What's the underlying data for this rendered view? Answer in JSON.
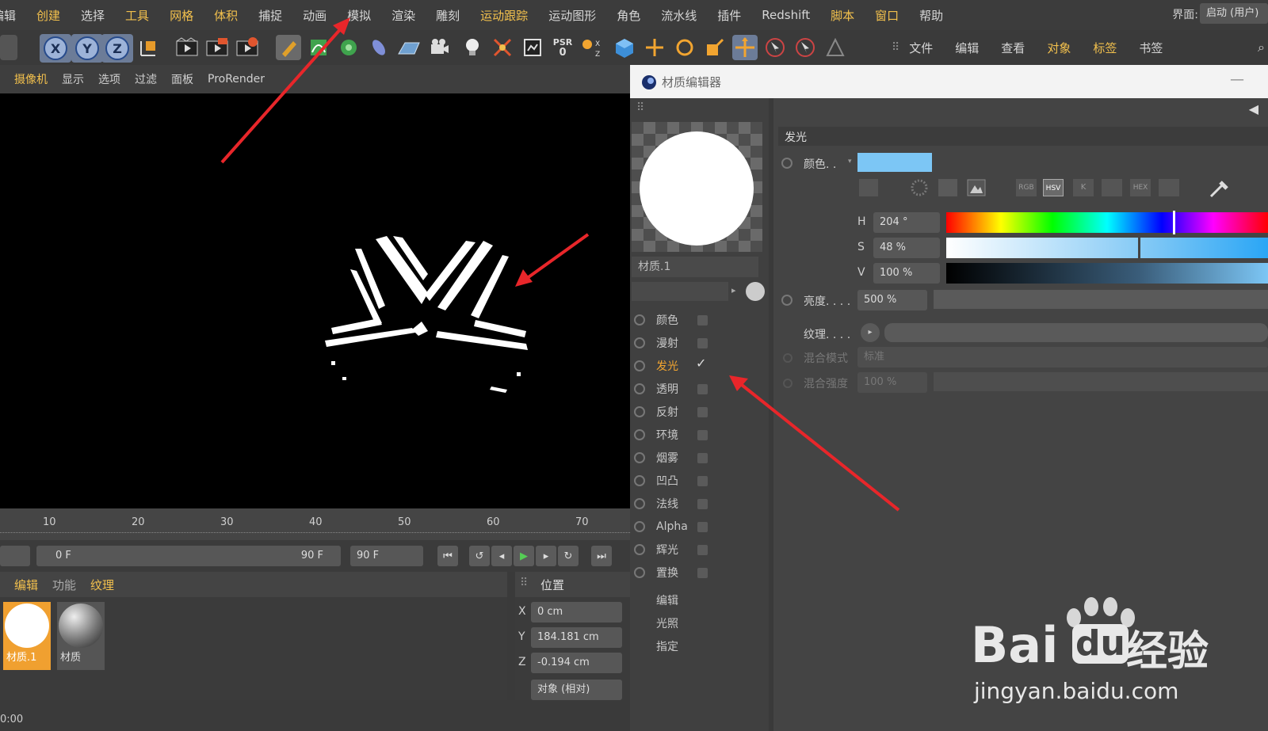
{
  "menubar": {
    "items": [
      "编辑",
      "创建",
      "选择",
      "工具",
      "网格",
      "体积",
      "捕捉",
      "动画",
      "模拟",
      "渲染",
      "雕刻",
      "运动跟踪",
      "运动图形",
      "角色",
      "流水线",
      "插件",
      "Redshift",
      "脚本",
      "窗口",
      "帮助"
    ],
    "highlighted": [
      11,
      17,
      18
    ],
    "ui_label": "界面:",
    "ui_value": "启动 (用户)"
  },
  "toolbar": {
    "axes": [
      "X",
      "Y",
      "Z"
    ],
    "psr_label": "PSR",
    "psr_value": "0"
  },
  "right_menu": [
    "文件",
    "编辑",
    "查看",
    "对象",
    "标签",
    "书签"
  ],
  "right_menu_highlighted": [
    3,
    4
  ],
  "viewport_menu": [
    "摄像机",
    "显示",
    "选项",
    "过滤",
    "面板",
    "ProRender"
  ],
  "timeline": {
    "ticks": [
      "10",
      "20",
      "30",
      "40",
      "50",
      "60",
      "70"
    ],
    "start_field": "0 F",
    "range_end": "90 F",
    "end_field": "90 F"
  },
  "material_manager": {
    "menu": [
      "编辑",
      "功能",
      "纹理"
    ],
    "materials": [
      {
        "name": "材质.1",
        "selected": true
      },
      {
        "name": "材质",
        "selected": false
      }
    ]
  },
  "coordinates": {
    "header": "位置",
    "rows": [
      {
        "axis": "X",
        "value": "0 cm"
      },
      {
        "axis": "Y",
        "value": "184.181 cm"
      },
      {
        "axis": "Z",
        "value": "-0.194 cm"
      }
    ],
    "mode": "对象 (相对)"
  },
  "status_time": "0:00",
  "material_editor": {
    "title": "材质编辑器",
    "material_name": "材质.1",
    "channels": [
      {
        "label": "颜色",
        "checked": false
      },
      {
        "label": "漫射",
        "checked": false
      },
      {
        "label": "发光",
        "checked": true,
        "active": true
      },
      {
        "label": "透明",
        "checked": false
      },
      {
        "label": "反射",
        "checked": false
      },
      {
        "label": "环境",
        "checked": false
      },
      {
        "label": "烟雾",
        "checked": false
      },
      {
        "label": "凹凸",
        "checked": false
      },
      {
        "label": "法线",
        "checked": false
      },
      {
        "label": "Alpha",
        "checked": false
      },
      {
        "label": "辉光",
        "checked": false
      },
      {
        "label": "置换",
        "checked": false
      }
    ],
    "extra_items": [
      "编辑",
      "光照",
      "指定"
    ],
    "section_title": "发光",
    "color_label": "颜色. .",
    "color_swatch": "#7cc6f5",
    "mode_buttons": [
      "RGB",
      "HSV",
      "K",
      "HEX"
    ],
    "hsv": [
      {
        "label": "H",
        "value": "204 °"
      },
      {
        "label": "S",
        "value": "48 %"
      },
      {
        "label": "V",
        "value": "100 %"
      }
    ],
    "brightness_label": "亮度. . . .",
    "brightness_value": "500 %",
    "texture_label": "纹理. . . .",
    "blend_mode_label": "混合模式",
    "blend_mode_value": "标准",
    "blend_strength_label": "混合强度",
    "blend_strength_value": "100 %"
  },
  "watermark": {
    "brand_a": "Bai",
    "brand_b": "du",
    "brand_cn": "经验",
    "url": "jingyan.baidu.com"
  }
}
